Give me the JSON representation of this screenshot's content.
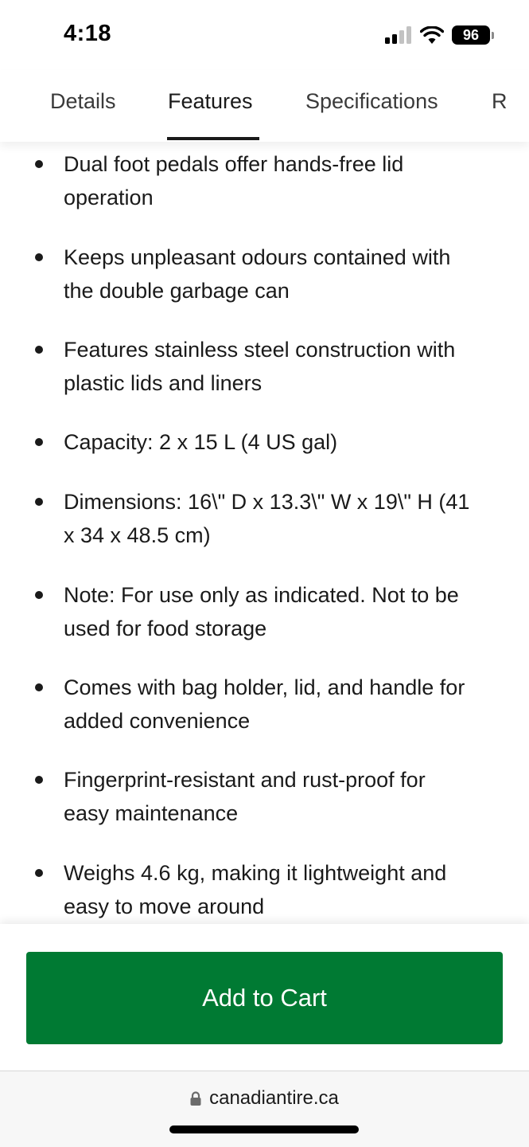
{
  "status_bar": {
    "time": "4:18",
    "battery": "96",
    "icons": [
      "signal-icon",
      "wifi-icon",
      "battery-icon"
    ]
  },
  "tabs": [
    {
      "label": "Details",
      "active": false
    },
    {
      "label": "Features",
      "active": true
    },
    {
      "label": "Specifications",
      "active": false
    },
    {
      "label": "R",
      "active": false
    }
  ],
  "features": [
    {
      "line1": "Dual foot pedals offer hands-free lid",
      "line2": "operation"
    },
    {
      "line1": "Keeps unpleasant odours contained with",
      "line2": "the double garbage can"
    },
    {
      "line1": "Features stainless steel construction with",
      "line2": "plastic lids and liners"
    },
    {
      "line1": "Capacity: 2 x 15 L (4 US gal)",
      "line2": ""
    },
    {
      "line1": "Dimensions: 16\\\" D x 13.3\\\" W x 19\\\" H (41",
      "line2": "x 34 x 48.5 cm)"
    },
    {
      "line1": "Note: For use only as indicated. Not to be",
      "line2": "used for food storage"
    },
    {
      "line1": "Comes with bag holder, lid, and handle for",
      "line2": "added convenience"
    },
    {
      "line1": "Fingerprint-resistant and rust-proof for",
      "line2": "easy maintenance"
    },
    {
      "line1": "Weighs 4.6 kg, making it lightweight and",
      "line2": "easy to move around"
    }
  ],
  "action": {
    "add_to_cart_label": "Add to Cart",
    "button_color": "#007a33"
  },
  "browser": {
    "url": "canadiantire.ca",
    "url_icon": "lock-icon"
  }
}
